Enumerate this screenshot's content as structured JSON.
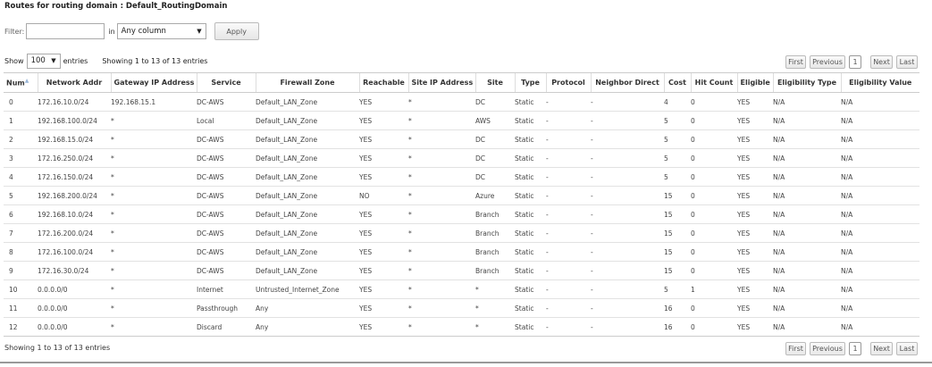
{
  "title": "Routes for routing domain : Default_RoutingDomain",
  "filter": {
    "label": "Filter:",
    "value": "",
    "in_label": "in",
    "column": "Any column",
    "apply_label": "Apply"
  },
  "length": {
    "show_label": "Show",
    "value": "100",
    "entries_label": "entries"
  },
  "info_top": "Showing 1 to 13 of 13 entries",
  "info_bottom": "Showing 1 to 13 of 13 entries",
  "pager": {
    "first": "First",
    "previous": "Previous",
    "page": "1",
    "next": "Next",
    "last": "Last"
  },
  "columns": [
    "Num",
    "Network Addr",
    "Gateway IP Address",
    "Service",
    "Firewall Zone",
    "Reachable",
    "Site IP Address",
    "Site",
    "Type",
    "Protocol",
    "Neighbor Direct",
    "Cost",
    "Hit Count",
    "Eligible",
    "Eligibility Type",
    "Eligibility Value"
  ],
  "rows": [
    [
      "0",
      "172.16.10.0/24",
      "192.168.15.1",
      "DC-AWS",
      "Default_LAN_Zone",
      "YES",
      "*",
      "DC",
      "Static",
      "-",
      "-",
      "4",
      "0",
      "YES",
      "N/A",
      "N/A"
    ],
    [
      "1",
      "192.168.100.0/24",
      "*",
      "Local",
      "Default_LAN_Zone",
      "YES",
      "*",
      "AWS",
      "Static",
      "-",
      "-",
      "5",
      "0",
      "YES",
      "N/A",
      "N/A"
    ],
    [
      "2",
      "192.168.15.0/24",
      "*",
      "DC-AWS",
      "Default_LAN_Zone",
      "YES",
      "*",
      "DC",
      "Static",
      "-",
      "-",
      "5",
      "0",
      "YES",
      "N/A",
      "N/A"
    ],
    [
      "3",
      "172.16.250.0/24",
      "*",
      "DC-AWS",
      "Default_LAN_Zone",
      "YES",
      "*",
      "DC",
      "Static",
      "-",
      "-",
      "5",
      "0",
      "YES",
      "N/A",
      "N/A"
    ],
    [
      "4",
      "172.16.150.0/24",
      "*",
      "DC-AWS",
      "Default_LAN_Zone",
      "YES",
      "*",
      "DC",
      "Static",
      "-",
      "-",
      "5",
      "0",
      "YES",
      "N/A",
      "N/A"
    ],
    [
      "5",
      "192.168.200.0/24",
      "*",
      "DC-AWS",
      "Default_LAN_Zone",
      "NO",
      "*",
      "Azure",
      "Static",
      "-",
      "-",
      "15",
      "0",
      "YES",
      "N/A",
      "N/A"
    ],
    [
      "6",
      "192.168.10.0/24",
      "*",
      "DC-AWS",
      "Default_LAN_Zone",
      "YES",
      "*",
      "Branch",
      "Static",
      "-",
      "-",
      "15",
      "0",
      "YES",
      "N/A",
      "N/A"
    ],
    [
      "7",
      "172.16.200.0/24",
      "*",
      "DC-AWS",
      "Default_LAN_Zone",
      "YES",
      "*",
      "Branch",
      "Static",
      "-",
      "-",
      "15",
      "0",
      "YES",
      "N/A",
      "N/A"
    ],
    [
      "8",
      "172.16.100.0/24",
      "*",
      "DC-AWS",
      "Default_LAN_Zone",
      "YES",
      "*",
      "Branch",
      "Static",
      "-",
      "-",
      "15",
      "0",
      "YES",
      "N/A",
      "N/A"
    ],
    [
      "9",
      "172.16.30.0/24",
      "*",
      "DC-AWS",
      "Default_LAN_Zone",
      "YES",
      "*",
      "Branch",
      "Static",
      "-",
      "-",
      "15",
      "0",
      "YES",
      "N/A",
      "N/A"
    ],
    [
      "10",
      "0.0.0.0/0",
      "*",
      "Internet",
      "Untrusted_Internet_Zone",
      "YES",
      "*",
      "*",
      "Static",
      "-",
      "-",
      "5",
      "1",
      "YES",
      "N/A",
      "N/A"
    ],
    [
      "11",
      "0.0.0.0/0",
      "*",
      "Passthrough",
      "Any",
      "YES",
      "*",
      "*",
      "Static",
      "-",
      "-",
      "16",
      "0",
      "YES",
      "N/A",
      "N/A"
    ],
    [
      "12",
      "0.0.0.0/0",
      "*",
      "Discard",
      "Any",
      "YES",
      "*",
      "*",
      "Static",
      "-",
      "-",
      "16",
      "0",
      "YES",
      "N/A",
      "N/A"
    ]
  ]
}
